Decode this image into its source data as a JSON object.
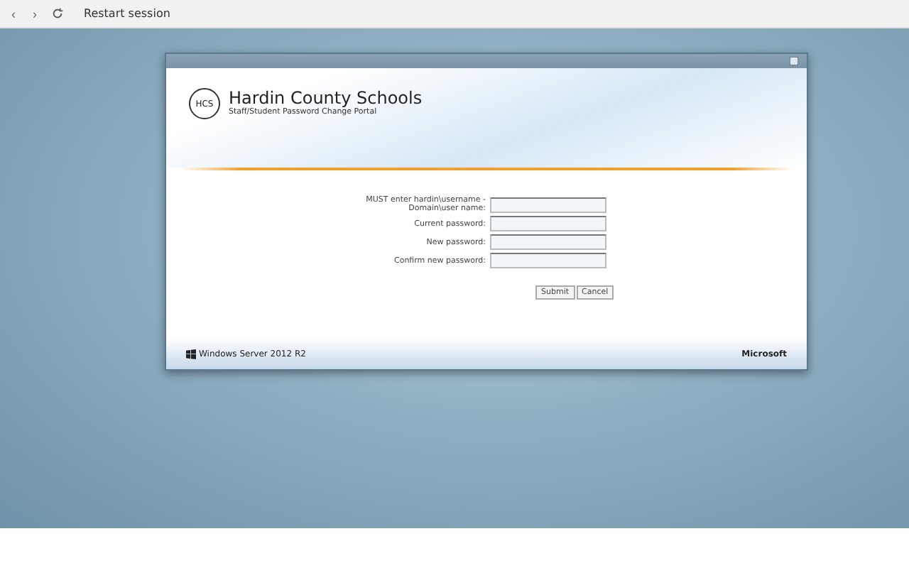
{
  "browser_bar": {
    "back": "‹",
    "forward": "›",
    "restart": "Restart session"
  },
  "dialog": {
    "org_logo": "HCS",
    "org_name": "Hardin County Schools",
    "subtitle": "Staff/Student Password Change Portal",
    "fields": [
      {
        "label": "MUST enter hardin\\username - Domain\\user name:"
      },
      {
        "label": "Current password:"
      },
      {
        "label": "New password:"
      },
      {
        "label": "Confirm new password:"
      }
    ],
    "buttons": [
      "Submit",
      "Cancel"
    ],
    "footer_left": "Windows Server 2012 R2",
    "footer_right": "Microsoft"
  }
}
